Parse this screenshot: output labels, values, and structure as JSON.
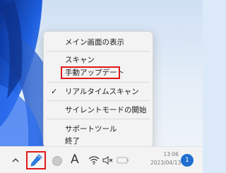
{
  "menu": {
    "items": [
      {
        "label": "メイン画面の表示",
        "checked": false
      },
      {
        "label": "スキャン",
        "checked": false
      },
      {
        "label": "手動アップデート",
        "checked": false,
        "highlighted": true
      },
      {
        "label": "リアルタイムスキャン",
        "checked": true
      },
      {
        "label": "サイレントモードの開始",
        "checked": false
      },
      {
        "label": "サポートツール",
        "checked": false
      },
      {
        "label": "終了",
        "checked": false
      }
    ],
    "check_glyph": "✓"
  },
  "taskbar": {
    "font_glyph": "A",
    "time": "13:06",
    "date": "2023/04/13",
    "notification_count": "1",
    "icons": [
      "chevron-up-icon",
      "pen-icon",
      "circle-icon",
      "font-icon",
      "wifi-icon",
      "volume-muted-icon",
      "battery-icon"
    ]
  },
  "colors": {
    "highlight": "#e0191a",
    "accent": "#1f6fd1",
    "wallpaper": "#cfe0f4"
  }
}
